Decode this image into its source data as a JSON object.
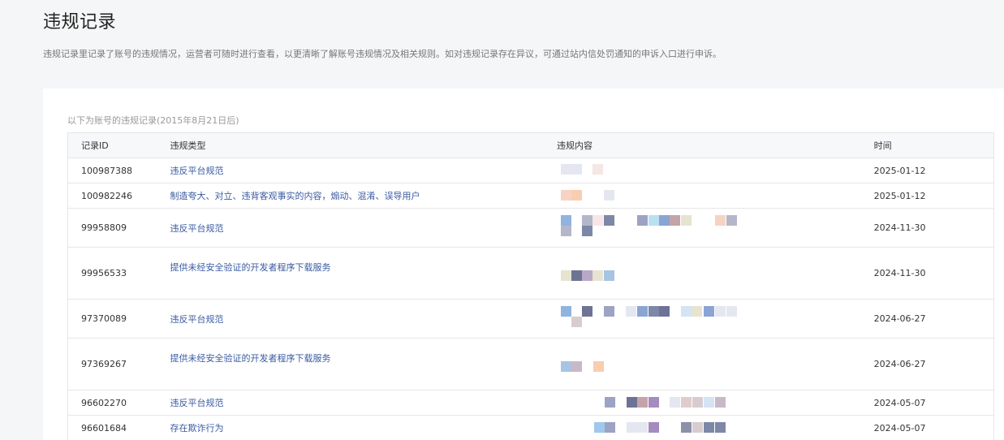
{
  "page": {
    "title": "违规记录",
    "description": "违规记录里记录了账号的违规情况，运营者可随时进行查看，以更清晰了解账号违规情况及相关规则。如对违规记录存在异议，可通过站内信处罚通知的申诉入口进行申诉。"
  },
  "records": {
    "caption": "以下为账号的违规记录(2015年8月21日后)",
    "columns": [
      "记录ID",
      "违规类型",
      "违规内容",
      "时间"
    ],
    "rows": [
      {
        "id": "100987388",
        "type": "违反平台规范",
        "time": "2025-01-12"
      },
      {
        "id": "100982246",
        "type": "制造夸大、对立、违背客观事实的内容，煽动、混淆、误导用户",
        "time": "2025-01-12"
      },
      {
        "id": "99958809",
        "type": "违反平台规范",
        "time": "2024-11-30"
      },
      {
        "id": "99956533",
        "type": "提供未经安全验证的开发者程序下载服务",
        "time": "2024-11-30"
      },
      {
        "id": "97370089",
        "type": "违反平台规范",
        "time": "2024-06-27"
      },
      {
        "id": "97369267",
        "type": "提供未经安全验证的开发者程序下载服务",
        "time": "2024-06-27"
      },
      {
        "id": "96602270",
        "type": "违反平台规范",
        "time": "2024-05-07"
      },
      {
        "id": "96601684",
        "type": "存在欺诈行为",
        "time": "2024-05-07"
      }
    ]
  },
  "colors": {
    "link": "#3a5ba0",
    "mosaic": [
      "#e4e7f0",
      "#f6e6e6",
      "#f7d3c3",
      "#f9cdb0",
      "#8fb4e0",
      "#b4b7c9",
      "#7d88a8",
      "#9da3c4",
      "#8aa4d4",
      "#b9e0f0",
      "#c3b9cc",
      "#c4a4a8",
      "#d4e4f4",
      "#6d7394",
      "#aab6d8",
      "#a8c4e4",
      "#e6e4d0",
      "#b8a8c8",
      "#d8ccd0",
      "#9aa4bc",
      "#a48cc0",
      "#e0cccc",
      "#c8b8c8",
      "#a0c8ec",
      "#8c90a8"
    ]
  }
}
